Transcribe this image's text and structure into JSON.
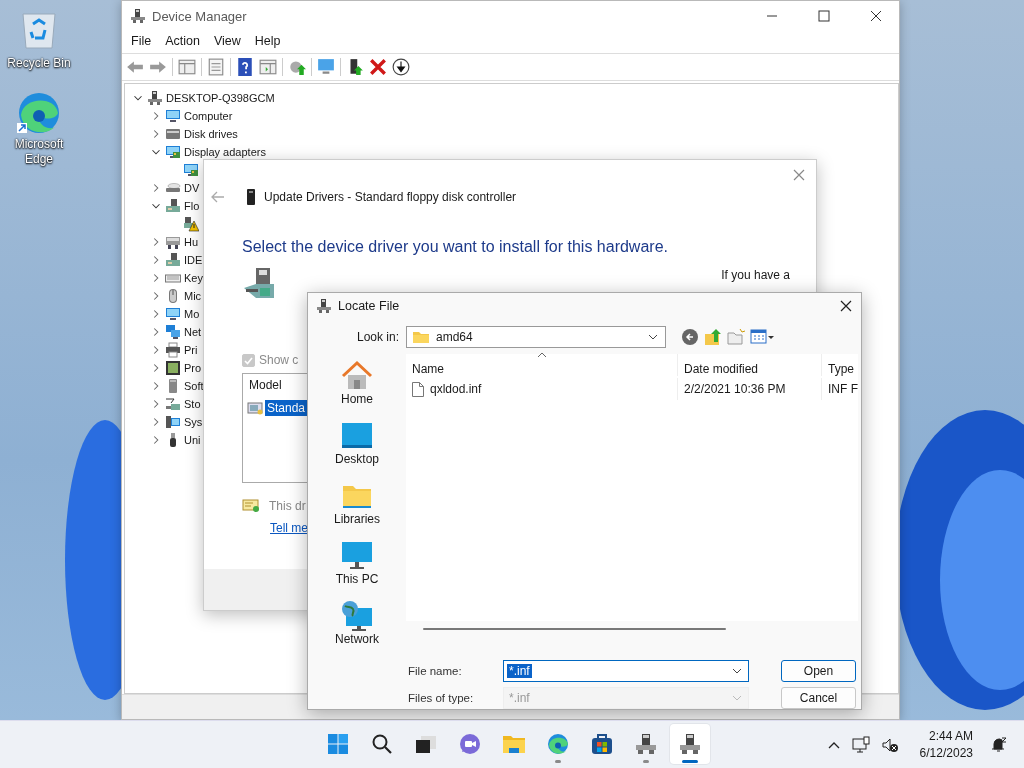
{
  "desktop_icons": [
    {
      "label": "Recycle Bin",
      "kind": "recycle"
    },
    {
      "label": "Microsoft Edge",
      "kind": "edge"
    }
  ],
  "device_manager": {
    "title": "Device Manager",
    "menu": [
      "File",
      "Action",
      "View",
      "Help"
    ],
    "tree": {
      "label": "DESKTOP-Q398GCM",
      "kind": "root",
      "expanded": true,
      "children": [
        {
          "label": "Computer",
          "kind": "monitor",
          "expanded": false
        },
        {
          "label": "Disk drives",
          "kind": "drive",
          "expanded": false
        },
        {
          "label": "Display adapters",
          "kind": "display",
          "expanded": true,
          "children": [
            {
              "kind": "display"
            }
          ]
        },
        {
          "label": "DV",
          "kind": "dvd",
          "expanded": false
        },
        {
          "label": "Flo",
          "kind": "controller",
          "expanded": true,
          "children": [
            {
              "kind": "warning"
            }
          ]
        },
        {
          "label": "Hu",
          "kind": "hid",
          "expanded": false
        },
        {
          "label": "IDE",
          "kind": "controller",
          "expanded": false
        },
        {
          "label": "Key",
          "kind": "keyboard",
          "expanded": false
        },
        {
          "label": "Mic",
          "kind": "mouse",
          "expanded": false
        },
        {
          "label": "Mo",
          "kind": "monitor",
          "expanded": false
        },
        {
          "label": "Net",
          "kind": "network",
          "expanded": false
        },
        {
          "label": "Pri",
          "kind": "printer",
          "expanded": false
        },
        {
          "label": "Pro",
          "kind": "processor",
          "expanded": false
        },
        {
          "label": "Soft",
          "kind": "software",
          "expanded": false
        },
        {
          "label": "Sto",
          "kind": "storage",
          "expanded": false
        },
        {
          "label": "Sys",
          "kind": "system",
          "expanded": false
        },
        {
          "label": "Uni",
          "kind": "usb",
          "expanded": false
        }
      ]
    }
  },
  "update_drivers": {
    "title": "Update Drivers - Standard floppy disk controller",
    "heading": "Select the device driver you want to install for this hardware.",
    "side_note": "If you have a",
    "show_compatible": {
      "label": "Show c",
      "checked": true,
      "disabled": true
    },
    "model_list": {
      "header": "Model",
      "items": [
        {
          "label": "Standa",
          "selected": true
        }
      ]
    },
    "signed_note": "This dr",
    "link": "Tell me"
  },
  "locate_file": {
    "title": "Locate File",
    "look_in": {
      "label": "Look in:",
      "value": "amd64"
    },
    "places": [
      {
        "label": "Home",
        "kind": "home"
      },
      {
        "label": "Desktop",
        "kind": "desktop"
      },
      {
        "label": "Libraries",
        "kind": "libraries"
      },
      {
        "label": "This PC",
        "kind": "pc"
      },
      {
        "label": "Network",
        "kind": "network"
      }
    ],
    "columns": [
      {
        "label": "Name",
        "sorted": true
      },
      {
        "label": "Date modified",
        "sorted": false
      },
      {
        "label": "Type",
        "sorted": false
      }
    ],
    "rows": [
      {
        "name": "qxldod.inf",
        "date": "2/2/2021 10:36 PM",
        "type": "INF F",
        "selected": false
      }
    ],
    "file_name": {
      "label": "File name:",
      "value": "*.inf",
      "text_selected": true
    },
    "file_type": {
      "label": "Files of type:",
      "value": "*.inf",
      "disabled": true
    },
    "buttons": [
      {
        "label": "Open",
        "default": true
      },
      {
        "label": "Cancel",
        "default": false
      }
    ]
  },
  "taskbar": {
    "apps": [
      {
        "kind": "start",
        "running": false,
        "active": false
      },
      {
        "kind": "search",
        "running": false,
        "active": false
      },
      {
        "kind": "taskview",
        "running": false,
        "active": false
      },
      {
        "kind": "chat",
        "running": false,
        "active": false
      },
      {
        "kind": "explorer",
        "running": false,
        "active": false
      },
      {
        "kind": "edge",
        "running": true,
        "active": false
      },
      {
        "kind": "store",
        "running": false,
        "active": false
      },
      {
        "kind": "devmgr",
        "running": true,
        "active": false
      },
      {
        "kind": "devmgr",
        "running": true,
        "active": true
      }
    ],
    "time": "2:44 AM",
    "date": "6/12/2023"
  }
}
